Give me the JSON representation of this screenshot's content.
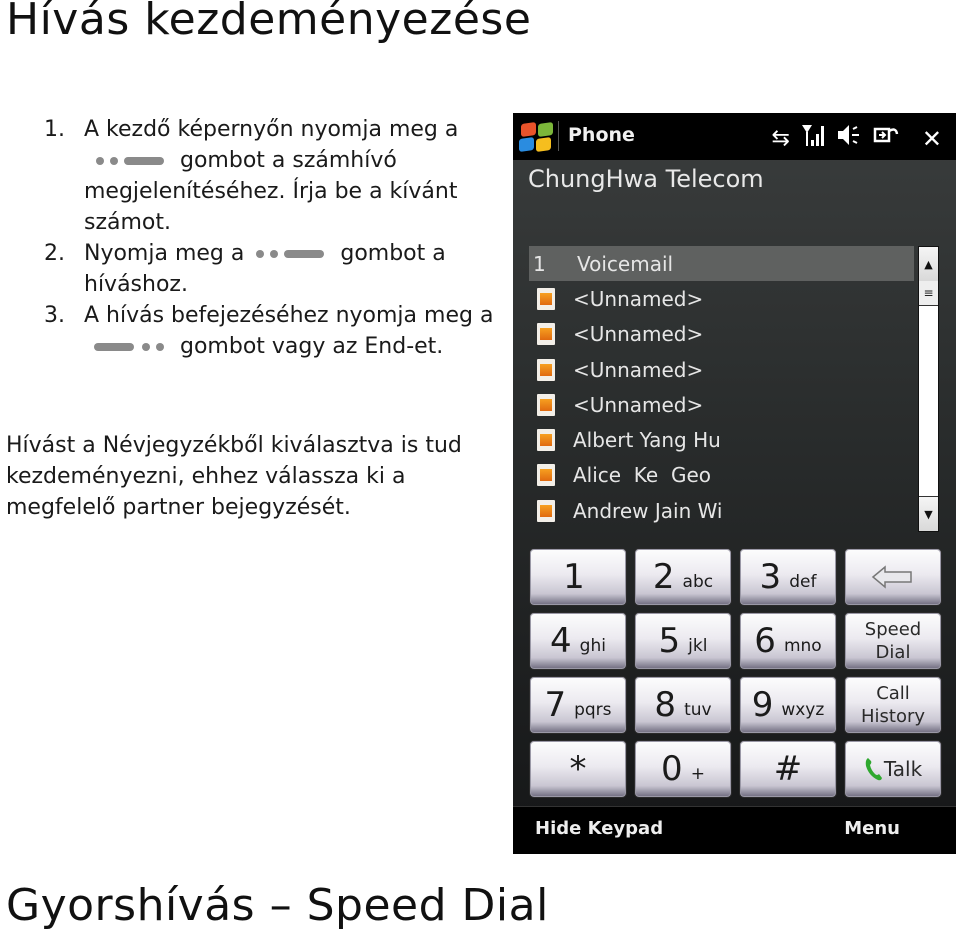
{
  "page": {
    "title": "Hívás kezdeményezése",
    "section_title": "Gyorshívás – Speed Dial",
    "steps": [
      {
        "num": "1.",
        "before": "A kezdő képernyőn nyomja meg a",
        "key_icon": "talk-key-icon",
        "after": "gombot a számhívó megjelenítéséhez. Írja be a kívánt számot."
      },
      {
        "num": "2.",
        "before": "Nyomja meg a",
        "key_icon": "talk-key-icon",
        "after": "gombot a híváshoz."
      },
      {
        "num": "3.",
        "before": "A hívás befejezéséhez nyomja meg a",
        "key_icon": "end-key-icon",
        "after": "gombot vagy az End-et."
      }
    ],
    "intro": "Hívást a Névjegyzékből kiválasztva is tud kezdeményezni, ehhez válassza ki a megfelelő partner bejegyzését."
  },
  "phone": {
    "titlebar": {
      "app_title": "Phone",
      "icons": [
        "start-logo-icon",
        "data-sync-icon",
        "signal-icon",
        "speaker-icon",
        "battery-plug-icon",
        "close-icon"
      ]
    },
    "operator": "ChungHwa Telecom",
    "list": [
      {
        "idx": "1",
        "label": "Voicemail",
        "selected": true,
        "icon": null
      },
      {
        "idx": "",
        "label": "<Unnamed>",
        "icon": "contact-card-icon"
      },
      {
        "idx": "",
        "label": "<Unnamed>",
        "icon": "contact-card-icon"
      },
      {
        "idx": "",
        "label": "<Unnamed>",
        "icon": "contact-card-icon"
      },
      {
        "idx": "",
        "label": "<Unnamed>",
        "icon": "contact-card-icon"
      },
      {
        "idx": "",
        "label": "Albert Yang Hu",
        "icon": "contact-card-icon"
      },
      {
        "idx": "",
        "label": "Alice  Ke  Geo",
        "icon": "contact-card-icon"
      },
      {
        "idx": "",
        "label": "Andrew Jain Wi",
        "icon": "contact-card-icon"
      }
    ],
    "keypad": [
      {
        "digit": "1",
        "letters": ""
      },
      {
        "digit": "2",
        "letters": "abc"
      },
      {
        "digit": "3",
        "letters": "def"
      },
      {
        "action": "backspace",
        "icon": "backspace-icon"
      },
      {
        "digit": "4",
        "letters": "ghi"
      },
      {
        "digit": "5",
        "letters": "jkl"
      },
      {
        "digit": "6",
        "letters": "mno"
      },
      {
        "action": "speed-dial",
        "line1": "Speed",
        "line2": "Dial"
      },
      {
        "digit": "7",
        "letters": "pqrs"
      },
      {
        "digit": "8",
        "letters": "tuv"
      },
      {
        "digit": "9",
        "letters": "wxyz"
      },
      {
        "action": "call-history",
        "line1": "Call",
        "line2": "History"
      },
      {
        "digit": "*",
        "letters": ""
      },
      {
        "digit": "0",
        "letters": "+"
      },
      {
        "digit": "#",
        "letters": ""
      },
      {
        "action": "talk",
        "label": "Talk",
        "icon": "phone-handset-icon"
      }
    ],
    "softkeys": {
      "left": "Hide Keypad",
      "right": "Menu"
    },
    "colors": {
      "talk_icon": "#2fa82f",
      "selected_row": "#5f6160",
      "titlebar": "#000000"
    }
  }
}
